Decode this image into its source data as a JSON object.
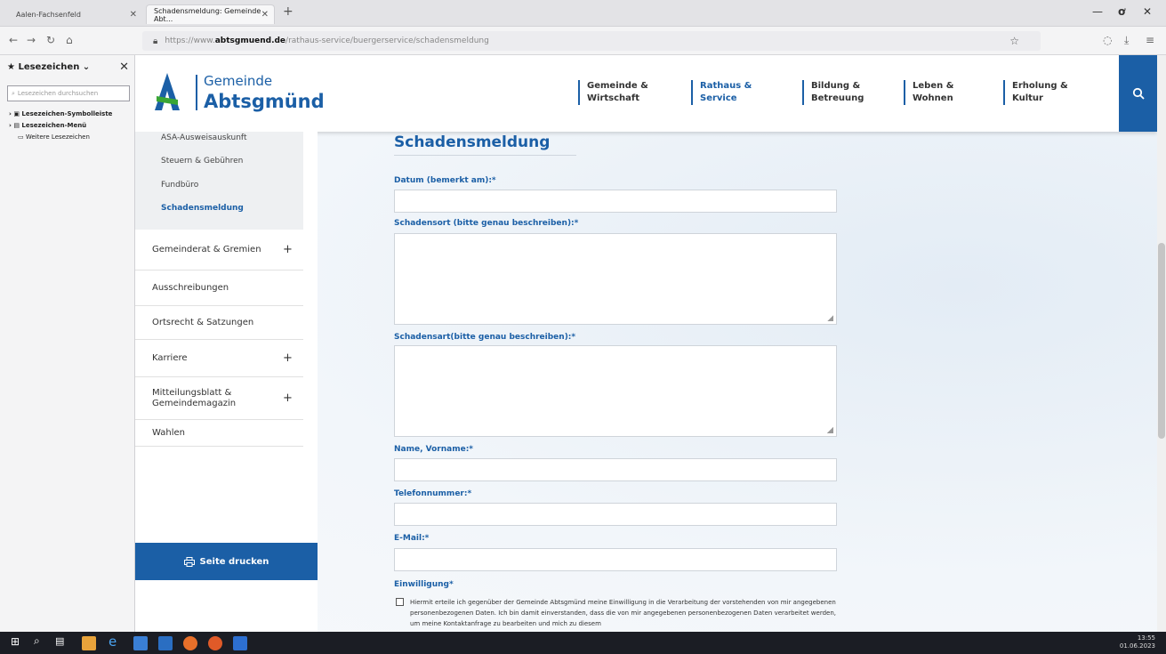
{
  "browser": {
    "tabs": [
      {
        "label": "Aalen-Fachsenfeld",
        "active": false
      },
      {
        "label": "Schadensmeldung: Gemeinde Abt...",
        "active": true
      }
    ],
    "url_prefix": "https://www.",
    "url_domain": "abtsgmuend.de",
    "url_path": "/rathaus-service/buergerservice/schadensmeldung"
  },
  "bookmarks": {
    "title": "Lesezeichen",
    "search_placeholder": "Lesezeichen durchsuchen",
    "items": [
      "Lesezeichen-Symbolleiste",
      "Lesezeichen-Menü",
      "Weitere Lesezeichen"
    ]
  },
  "site": {
    "logo_line1": "Gemeinde",
    "logo_line2": "Abtsgmünd",
    "nav": [
      {
        "label": "Gemeinde &\nWirtschaft",
        "active": false
      },
      {
        "label": "Rathaus &\nService",
        "active": true
      },
      {
        "label": "Bildung &\nBetreuung",
        "active": false
      },
      {
        "label": "Leben &\nWohnen",
        "active": false
      },
      {
        "label": "Erholung &\nKultur",
        "active": false
      }
    ],
    "subnav": [
      "ASA-Ausweisauskunft",
      "Steuern & Gebühren",
      "Fundbüro",
      "Schadensmeldung"
    ],
    "menu": [
      {
        "label": "Gemeinderat & Gremien",
        "plus": "+"
      },
      {
        "label": "Ausschreibungen",
        "plus": ""
      },
      {
        "label": "Ortsrecht & Satzungen",
        "plus": ""
      },
      {
        "label": "Karriere",
        "plus": "+"
      },
      {
        "label": "Mitteilungsblatt & Gemeindemagazin",
        "plus": "+"
      },
      {
        "label": "Wahlen",
        "plus": ""
      }
    ],
    "print_label": "Seite drucken"
  },
  "form": {
    "title": "Schadensmeldung",
    "date_label": "Datum (bemerkt am):*",
    "location_label": "Schadensort (bitte genau beschreiben):*",
    "type_label": "Schadensart(bitte genau beschreiben):*",
    "name_label": "Name, Vorname:*",
    "phone_label": "Telefonnummer:*",
    "email_label": "E-Mail:*",
    "consent_label": "Einwilligung*",
    "consent_text": "Hiermit erteile ich gegenüber der Gemeinde Abtsgmünd meine Einwilligung in die Verarbeitung der vorstehenden von mir angegebenen personenbezogenen Daten. Ich bin damit einverstanden, dass die von mir angegebenen personenbezogenen Daten verarbeitet werden, um meine Kontaktanfrage zu bearbeiten und mich zu diesem"
  },
  "taskbar": {
    "time": "13:55",
    "date": "01.06.2023"
  },
  "colors": {
    "brand_blue": "#1b5fa6",
    "logo_green": "#3aa635"
  }
}
